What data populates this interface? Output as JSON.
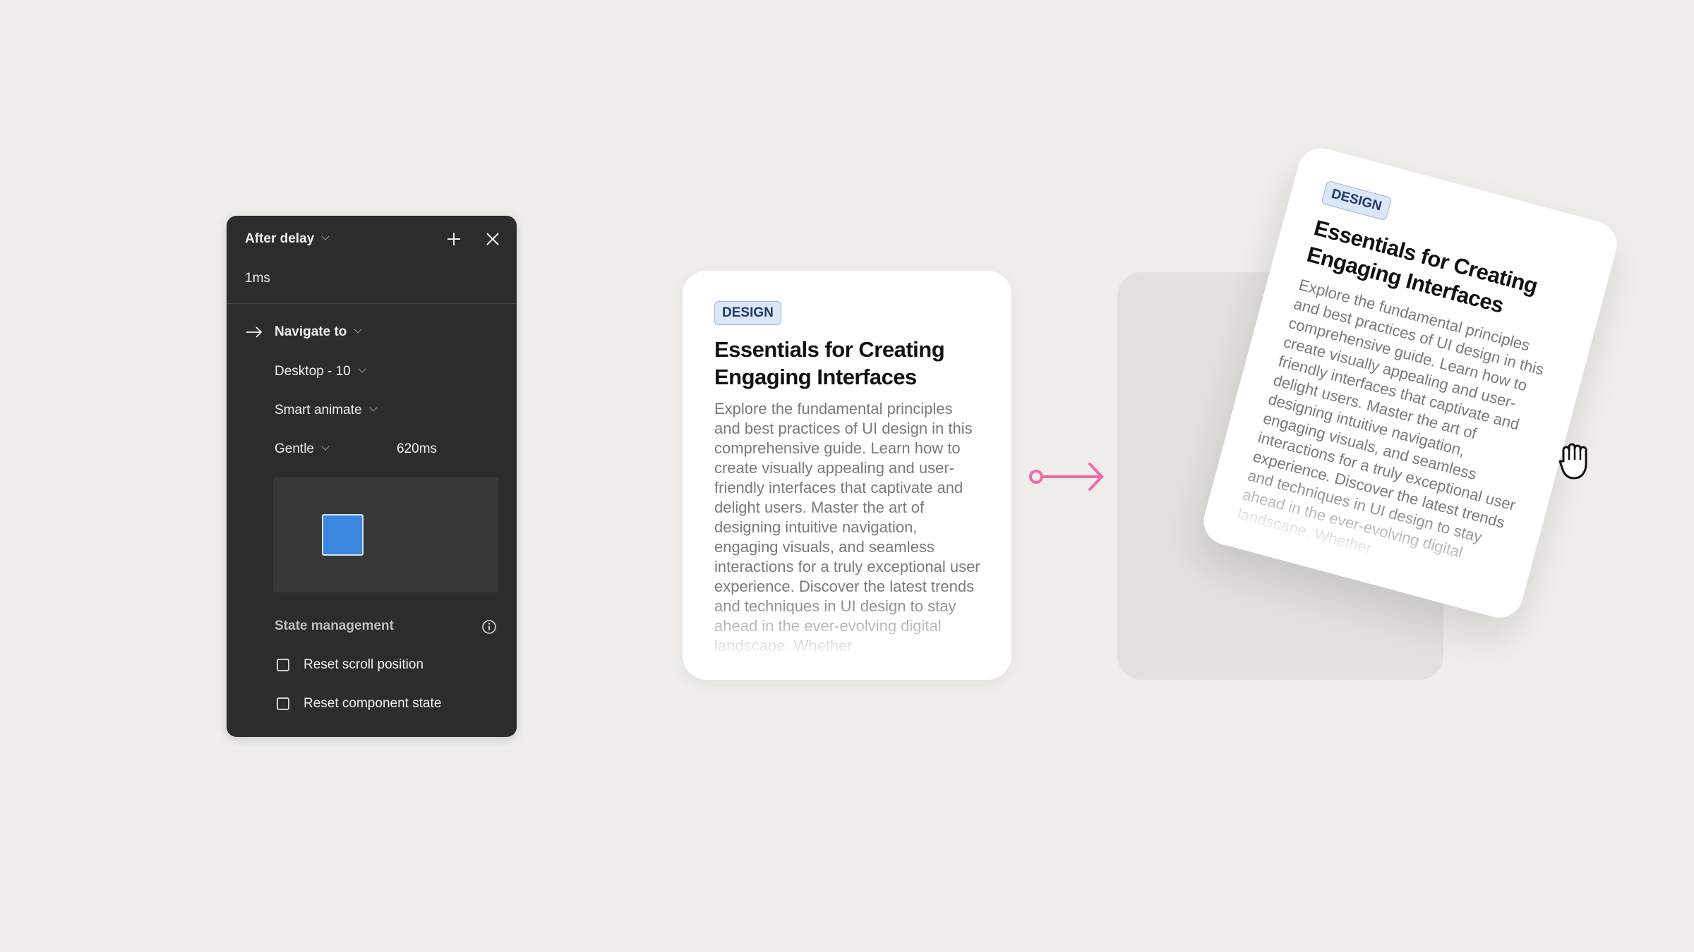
{
  "panel": {
    "trigger": "After delay",
    "delay": "1ms",
    "action": "Navigate to",
    "destination": "Desktop - 10",
    "animation": "Smart animate",
    "easing": "Gentle",
    "duration": "620ms",
    "preview_color": "#3b87e0",
    "state_heading": "State management",
    "checkboxes": [
      {
        "label": "Reset scroll position",
        "checked": false
      },
      {
        "label": "Reset component state",
        "checked": false
      }
    ]
  },
  "card": {
    "badge": "DESIGN",
    "title": "Essentials for Creating Engaging Interfaces",
    "body": "Explore the fundamental principles and best practices of UI design in this comprehensive guide. Learn how to create visually appealing and user-friendly interfaces that captivate and delight users. Master the art of designing intuitive navigation, engaging visuals, and seamless interactions for a truly exceptional user experience. Discover the latest trends and techniques in UI design to stay ahead in the ever-evolving digital landscape. Whether"
  },
  "arrow_color": "#f06aa8",
  "icons": [
    "plus-icon",
    "close-icon",
    "arrow-right-icon",
    "chevron-down-icon",
    "info-icon",
    "hand-grab-icon"
  ]
}
